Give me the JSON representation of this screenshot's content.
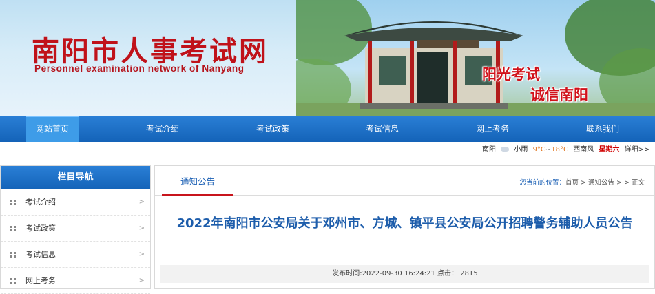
{
  "site": {
    "title": "南阳市人事考试网",
    "subtitle": "Personnel examination network of Nanyang",
    "slogan_line1": "阳光考试",
    "slogan_line2": "诚信南阳",
    "banner_image_name": "pavilion-photo"
  },
  "nav": {
    "items": [
      {
        "label": "网站首页"
      },
      {
        "label": "考试介绍"
      },
      {
        "label": "考试政策"
      },
      {
        "label": "考试信息"
      },
      {
        "label": "网上考务"
      },
      {
        "label": "联系我们"
      }
    ],
    "active_index": 0,
    "color": "#1a6cc7"
  },
  "weather": {
    "city": "南阳",
    "condition": "小雨",
    "low": "9°C",
    "sep": "~",
    "high": "18°C",
    "wind": "西南风",
    "weekday": "星期六",
    "details": "详细>>"
  },
  "sidebar": {
    "heading": "栏目导航",
    "items": [
      {
        "label": "考试介绍"
      },
      {
        "label": "考试政策"
      },
      {
        "label": "考试信息"
      },
      {
        "label": "网上考务"
      }
    ],
    "arrow": ">"
  },
  "main": {
    "tab": "通知公告",
    "breadcrumb": {
      "lead": "您当前的位置：",
      "path": "首页 > 通知公告 > > 正文"
    },
    "article_title": "2022年南阳市公安局关于邓州市、方城、镇平县公安局公开招聘警务辅助人员公告",
    "meta": "发布时间:2022-09-30 16:24:21 点击：  2815"
  }
}
